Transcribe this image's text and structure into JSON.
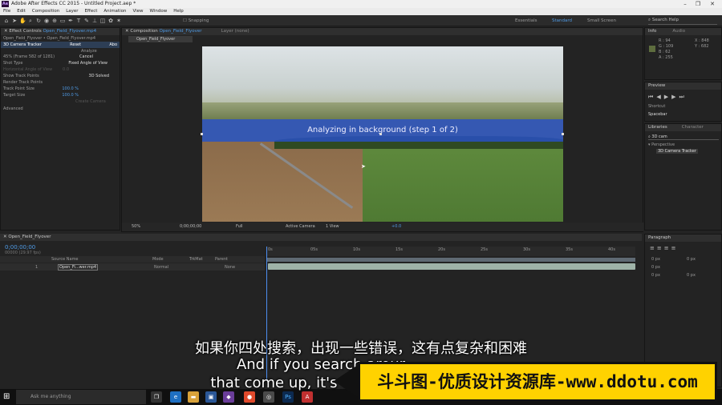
{
  "window": {
    "title": "Adobe After Effects CC 2015 - Untitled Project.aep *",
    "app_icon": "Ae"
  },
  "menu": [
    "File",
    "Edit",
    "Composition",
    "Layer",
    "Effect",
    "Animation",
    "View",
    "Window",
    "Help"
  ],
  "toolbar": {
    "snapping": "Snapping",
    "workspaces": [
      "Essentials",
      "Standard",
      "Small Screen"
    ],
    "search_help": "Search Help"
  },
  "effect_controls": {
    "tab": "Effect Controls",
    "tab_file": "Open_Field_Flyover.mp4",
    "breadcrumb": "Open_Field_Flyover • Open_Field_Flyover.mp4",
    "effect_name": "3D Camera Tracker",
    "reset": "Reset",
    "about": "Abo",
    "analyze": "Analyze",
    "status": "45% (Frame 582 of 1281)",
    "cancel": "Cancel",
    "shot_type_label": "Shot Type",
    "shot_type_value": "Fixed Angle of View",
    "hfov_label": "Horizontal Angle of View",
    "hfov_value": "0.0",
    "show_track_label": "Show Track Points",
    "show_track_value": "3D Solved",
    "render_track_label": "Render Track Points",
    "track_size_label": "Track Point Size",
    "track_size_value": "100.0 %",
    "target_size_label": "Target Size",
    "target_size_value": "100.0 %",
    "create_camera": "Create Camera",
    "advanced": "Advanced"
  },
  "composition": {
    "tab": "Composition",
    "tab_name": "Open_Field_Flyover",
    "layer_tab": "Layer (none)",
    "comp_label": "Open_Field_Flyover",
    "analyzing": "Analyzing in background (step 1 of 2)",
    "zoom": "50%",
    "timecode": "0;00;00;00",
    "resolution": "Full",
    "view": "Active Camera",
    "views": "1 View",
    "exposure": "+0.0"
  },
  "info": {
    "tab": "Info",
    "tab2": "Audio",
    "r": "R : 94",
    "g": "G : 109",
    "b": "B : 62",
    "a": "A : 255",
    "x": "X : 848",
    "y": "Y : 682",
    "swatch_color": "#5e6d3e"
  },
  "preview": {
    "tab": "Preview",
    "shortcut_label": "Shortcut",
    "shortcut_value": "Spacebar"
  },
  "libraries": {
    "tab": "Libraries",
    "tab2": "Character",
    "search": "3D cam",
    "group": "Perspective",
    "item": "3D Camera Tracker"
  },
  "timeline": {
    "tab": "Open_Field_Flyover",
    "timecode": "0;00;00;00",
    "fps": "00000 (29.97 fps)",
    "col_source": "Source Name",
    "col_mode": "Mode",
    "col_trkmat": "TrkMat",
    "col_parent": "Parent",
    "layer_num": "1",
    "layer_name": "Open_Fi...wer.mp4",
    "layer_mode": "Normal",
    "layer_parent": "None",
    "ruler": [
      "0s",
      "05s",
      "10s",
      "15s",
      "20s",
      "25s",
      "30s",
      "35s",
      "40s"
    ]
  },
  "paragraph": {
    "tab": "Paragraph",
    "v1": "0 px",
    "v2": "0 px",
    "v3": "0 px",
    "v4": "0 px",
    "v5": "0 px"
  },
  "taskbar": {
    "search": "Ask me anything"
  },
  "subtitles": {
    "cn": "如果你四处搜索，出现一些错误，这有点复杂和困难",
    "en1": "And if you search arour",
    "en2": "that come up, it's  d"
  },
  "watermark": "斗斗图-优质设计资源库-www.ddotu.com"
}
